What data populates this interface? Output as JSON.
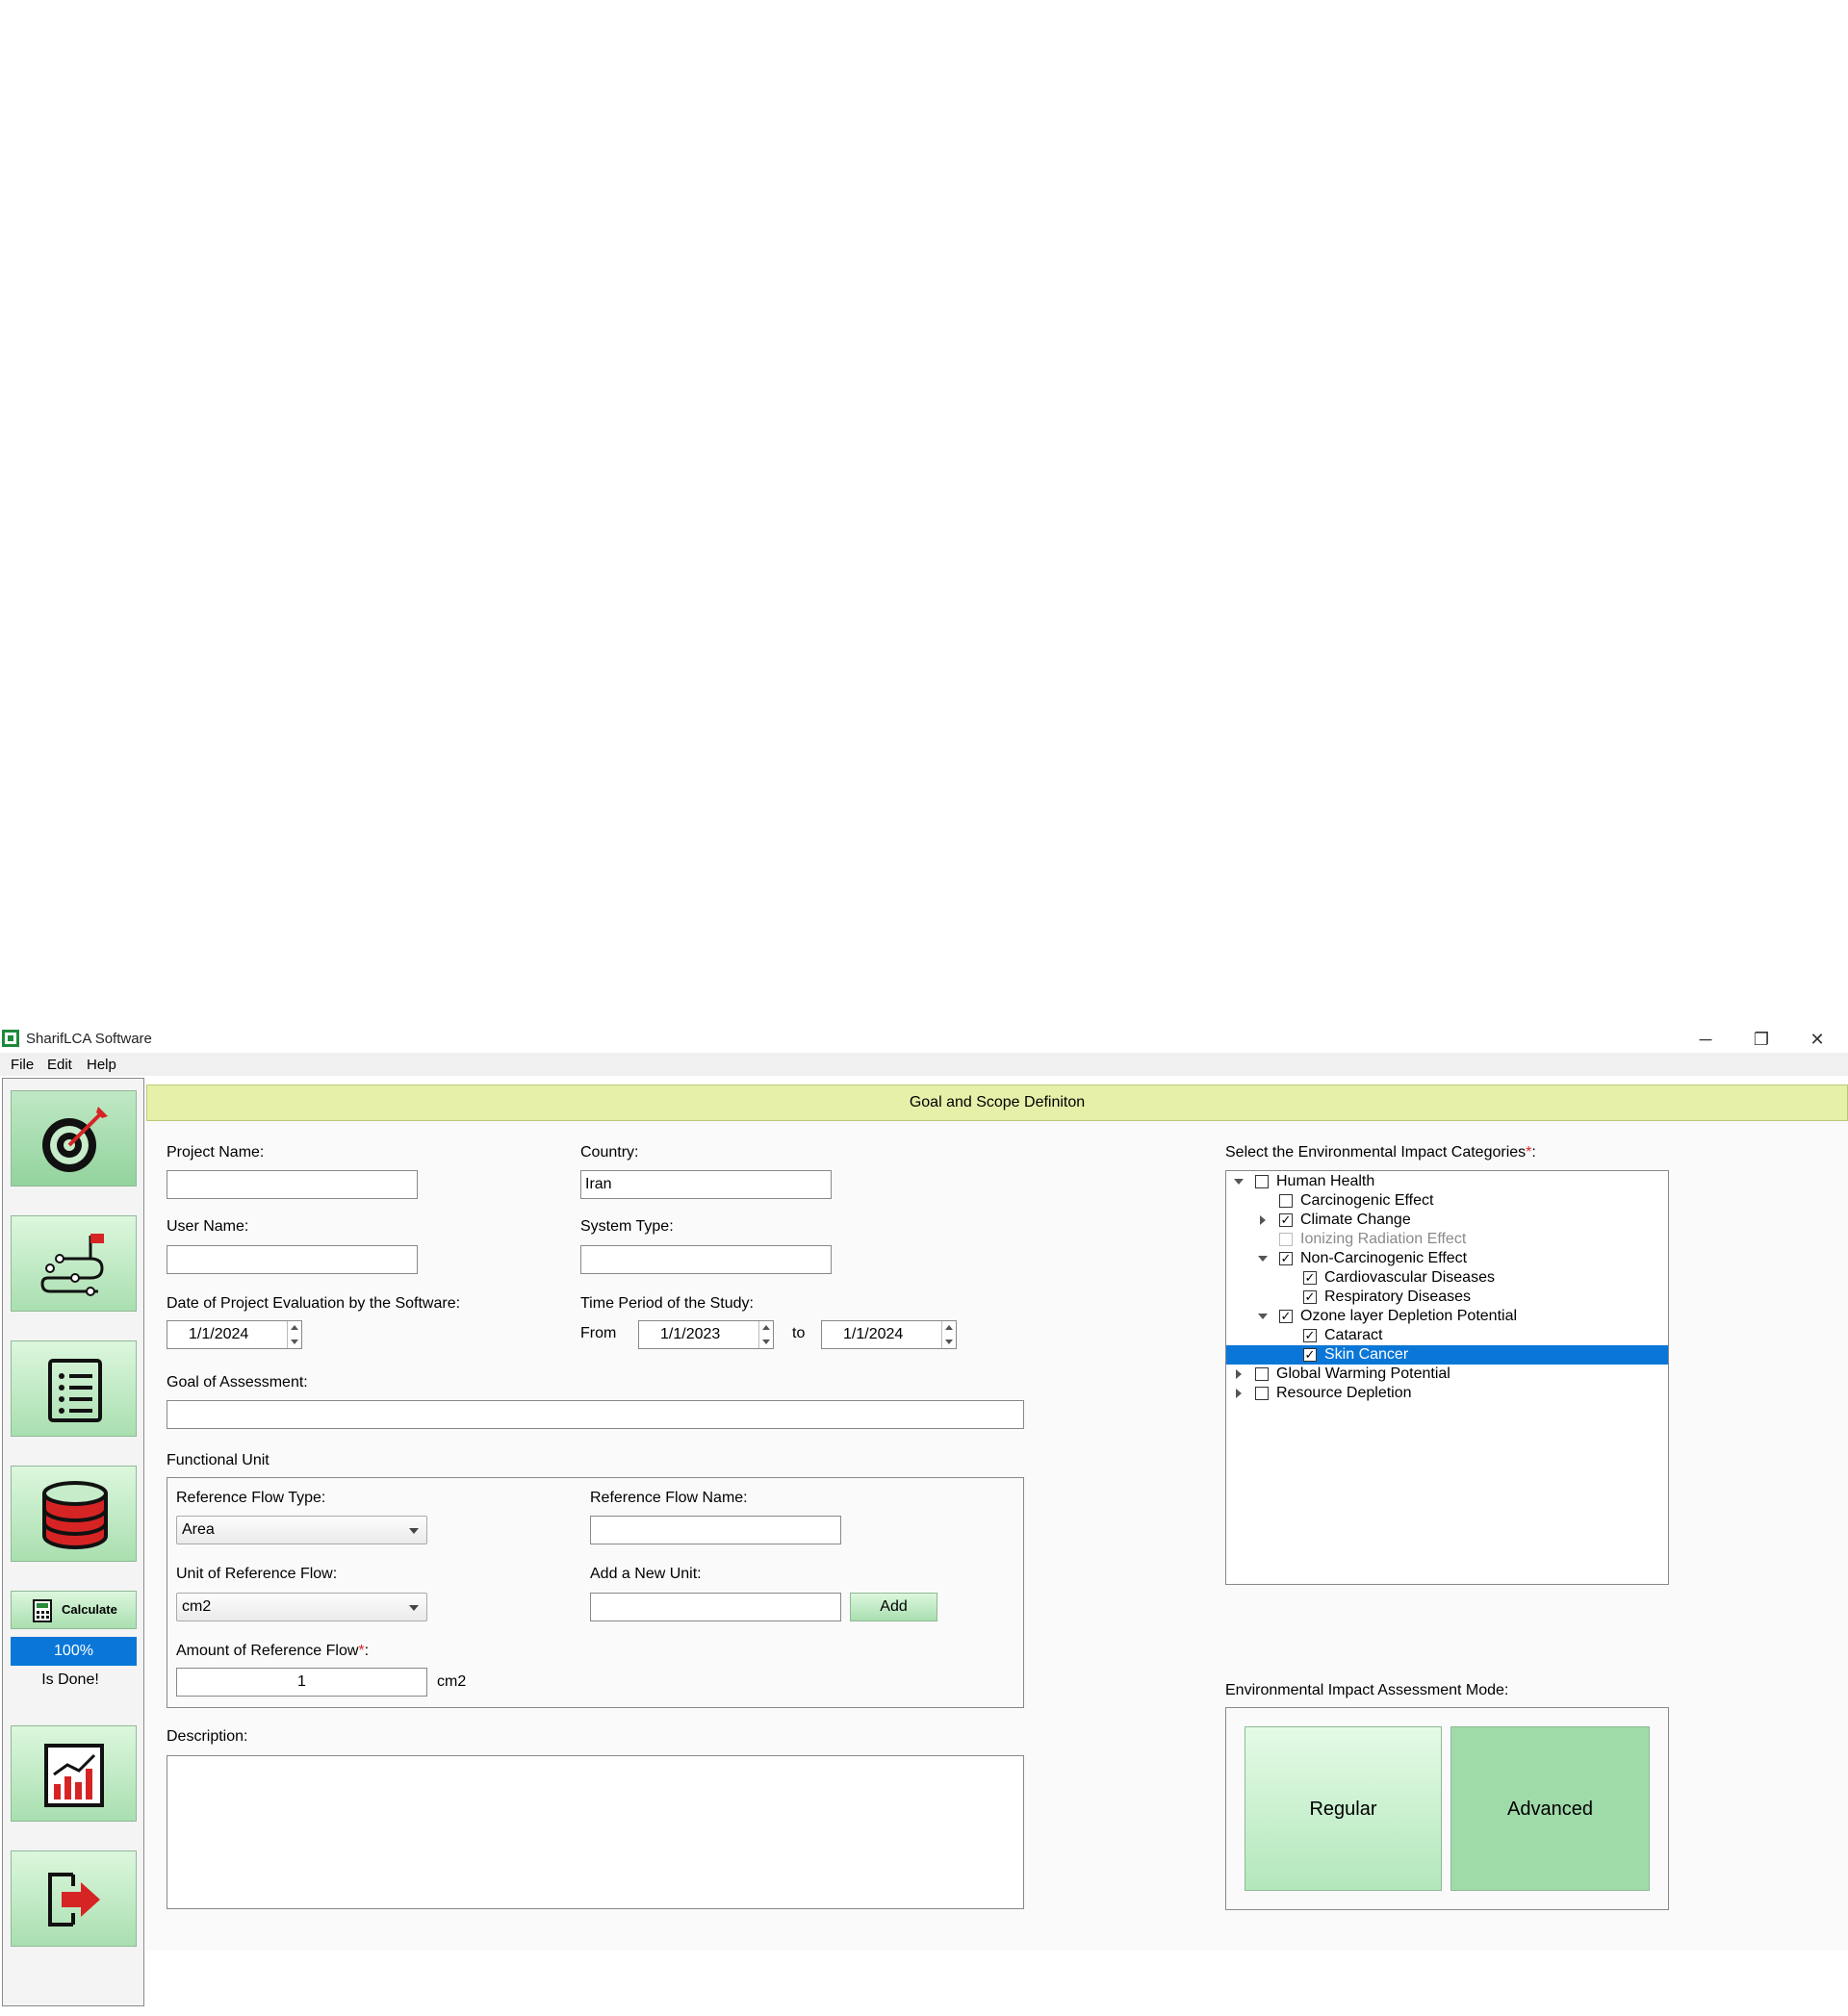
{
  "window": {
    "title": "SharifLCA Software",
    "minimize": "─",
    "maximize": "❐",
    "close": "✕"
  },
  "menu": {
    "file": "File",
    "edit": "Edit",
    "help": "Help"
  },
  "sidebar": {
    "calculate_label": "Calculate",
    "progress_text": "100%",
    "progress_value": 100,
    "status_text": "Is Done!",
    "nav_icons": [
      "target-icon",
      "route-icon",
      "list-icon",
      "database-icon",
      "bar-chart-icon",
      "exit-icon"
    ]
  },
  "header": {
    "title": "Goal and Scope Definiton"
  },
  "form": {
    "project_name_label": "Project Name:",
    "project_name_value": "",
    "country_label": "Country:",
    "country_value": "Iran",
    "user_name_label": "User Name:",
    "user_name_value": "",
    "system_type_label": "System Type:",
    "system_type_value": "",
    "date_eval_label": "Date of Project Evaluation by the Software:",
    "date_eval_value": "1/1/2024",
    "time_period_label": "Time Period of the Study:",
    "from_label": "From",
    "from_value": "1/1/2023",
    "to_label": "to",
    "to_value": "1/1/2024",
    "goal_label": "Goal of Assessment:",
    "goal_value": "",
    "functional_unit_label": "Functional Unit",
    "ref_flow_type_label": "Reference Flow Type:",
    "ref_flow_type_value": "Area",
    "ref_flow_name_label": "Reference Flow Name:",
    "ref_flow_name_value": "",
    "unit_label": "Unit of Reference Flow:",
    "unit_value": "cm2",
    "new_unit_label": "Add a New Unit:",
    "new_unit_value": "",
    "add_button": "Add",
    "amount_label": "Amount of Reference Flow",
    "required_mark": "*",
    "colon": ":",
    "amount_value": "1",
    "amount_unit": "cm2",
    "description_label": "Description:"
  },
  "impact": {
    "label": "Select the Environmental Impact Categories",
    "required_mark": "*",
    "colon": ":",
    "tree": [
      {
        "label": "Human Health",
        "checked": false
      },
      {
        "label": "Carcinogenic Effect",
        "checked": false
      },
      {
        "label": "Climate Change",
        "checked": true
      },
      {
        "label": "Ionizing Radiation Effect",
        "checked": false,
        "disabled": true
      },
      {
        "label": "Non-Carcinogenic Effect",
        "checked": true
      },
      {
        "label": "Cardiovascular Diseases",
        "checked": true
      },
      {
        "label": "Respiratory Diseases",
        "checked": true
      },
      {
        "label": "Ozone layer Depletion Potential",
        "checked": true
      },
      {
        "label": "Cataract",
        "checked": true
      },
      {
        "label": "Skin Cancer",
        "checked": true,
        "selected": true
      },
      {
        "label": "Global Warming Potential",
        "checked": false
      },
      {
        "label": "Resource Depletion",
        "checked": false
      }
    ]
  },
  "mode": {
    "label": "Environmental Impact Assessment Mode:",
    "regular": "Regular",
    "advanced": "Advanced",
    "selected": "Advanced"
  }
}
